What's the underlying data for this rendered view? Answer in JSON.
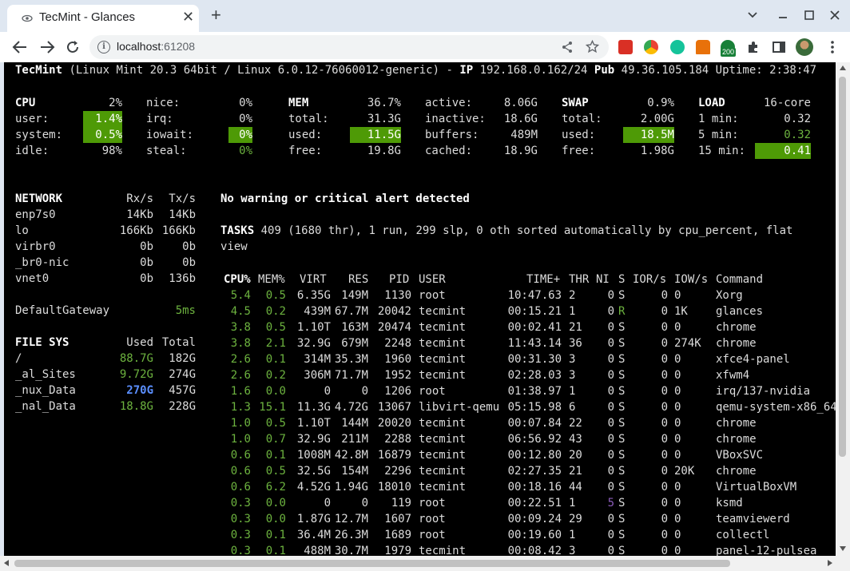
{
  "browser": {
    "tab_title": "TecMint - Glances",
    "tab_close": "✕",
    "new_tab": "+",
    "url_host": "localhost",
    "url_port": ":61208",
    "extension_badge": "200",
    "icons": [
      "back-icon",
      "forward-icon",
      "reload-icon",
      "info-icon",
      "share-icon",
      "star-icon",
      "extensions-icon",
      "side-panel-icon",
      "profile-avatar-icon",
      "menu-icon"
    ]
  },
  "header": {
    "hostname": "TecMint",
    "os": "(Linux Mint 20.3 64bit / Linux 6.0.12-76060012-generic) - ",
    "ip_label": "IP",
    "ip": "192.168.0.162/24",
    "pub_label": "Pub",
    "pub": "49.36.105.184",
    "uptime": "Uptime: 2:38:47"
  },
  "cpu": {
    "label": "CPU",
    "total": "2%",
    "user_label": "user:",
    "user": "1.4%",
    "system_label": "system:",
    "system": "0.5%",
    "idle_label": "idle:",
    "idle": "98%",
    "nice_label": "nice:",
    "nice": "0%",
    "irq_label": "irq:",
    "irq": "0%",
    "iowait_label": "iowait:",
    "iowait": "0%",
    "steal_label": "steal:",
    "steal": "0%"
  },
  "mem": {
    "label": "MEM",
    "total_pct": "36.7%",
    "total_label": "total:",
    "total": "31.3G",
    "used_label": "used:",
    "used": "11.5G",
    "free_label": "free:",
    "free": "19.8G",
    "active_label": "active:",
    "active": "8.06G",
    "inactive_label": "inactive:",
    "inactive": "18.6G",
    "buffers_label": "buffers:",
    "buffers": "489M",
    "cached_label": "cached:",
    "cached": "18.9G"
  },
  "swap": {
    "label": "SWAP",
    "pct": "0.9%",
    "total_label": "total:",
    "total": "2.00G",
    "used_label": "used:",
    "used": "18.5M",
    "free_label": "free:",
    "free": "1.98G"
  },
  "load": {
    "label": "LOAD",
    "cores": "16-core",
    "m1_label": "1 min:",
    "m1": "0.32",
    "m5_label": "5 min:",
    "m5": "0.32",
    "m15_label": "15 min:",
    "m15": "0.41"
  },
  "network": {
    "label": "NETWORK",
    "rx_label": "Rx/s",
    "tx_label": "Tx/s",
    "rows": [
      {
        "name": "enp7s0",
        "rx": "14Kb",
        "tx": "14Kb"
      },
      {
        "name": "lo",
        "rx": "166Kb",
        "tx": "166Kb"
      },
      {
        "name": "virbr0",
        "rx": "0b",
        "tx": "0b"
      },
      {
        "name": "_br0-nic",
        "rx": "0b",
        "tx": "0b"
      },
      {
        "name": "vnet0",
        "rx": "0b",
        "tx": "136b"
      }
    ],
    "gateway_label": "DefaultGateway",
    "gateway": "5ms"
  },
  "filesys": {
    "label": "FILE SYS",
    "used_label": "Used",
    "total_label": "Total",
    "rows": [
      {
        "name": "/",
        "used": "88.7G",
        "total": "182G"
      },
      {
        "name": "_al_Sites",
        "used": "9.72G",
        "total": "274G"
      },
      {
        "name": "_nux_Data",
        "used": "270G",
        "total": "457G"
      },
      {
        "name": "_nal_Data",
        "used": "18.8G",
        "total": "228G"
      }
    ]
  },
  "alert": "No warning or critical alert detected",
  "tasks": {
    "label": "TASKS",
    "line1": " 409 (1680 thr), 1 run, 299 slp, 0 oth sorted automatically by cpu_percent, flat",
    "line2": "view"
  },
  "process_header": {
    "cpu": "CPU%",
    "mem": "MEM%",
    "virt": "VIRT",
    "res": "RES",
    "pid": "PID",
    "user": "USER",
    "time": "TIME+",
    "thr": "THR",
    "ni": "NI",
    "s": "S",
    "ior": "IOR/s",
    "iow": "IOW/s",
    "cmd": "Command"
  },
  "processes": [
    {
      "cpu": "5.4",
      "mem": "0.5",
      "virt": "6.35G",
      "res": "149M",
      "pid": "1130",
      "user": "root",
      "time": "10:47.63",
      "thr": "2",
      "ni": "0",
      "s": "S",
      "ior": "0",
      "iow": "0",
      "cmd": "Xorg"
    },
    {
      "cpu": "4.5",
      "mem": "0.2",
      "virt": "439M",
      "res": "67.7M",
      "pid": "20042",
      "user": "tecmint",
      "time": "00:15.21",
      "thr": "1",
      "ni": "0",
      "s": "R",
      "ior": "0",
      "iow": "1K",
      "cmd": "glances"
    },
    {
      "cpu": "3.8",
      "mem": "0.5",
      "virt": "1.10T",
      "res": "163M",
      "pid": "20474",
      "user": "tecmint",
      "time": "00:02.41",
      "thr": "21",
      "ni": "0",
      "s": "S",
      "ior": "0",
      "iow": "0",
      "cmd": "chrome"
    },
    {
      "cpu": "3.8",
      "mem": "2.1",
      "virt": "32.9G",
      "res": "679M",
      "pid": "2248",
      "user": "tecmint",
      "time": "11:43.14",
      "thr": "36",
      "ni": "0",
      "s": "S",
      "ior": "0",
      "iow": "274K",
      "cmd": "chrome"
    },
    {
      "cpu": "2.6",
      "mem": "0.1",
      "virt": "314M",
      "res": "35.3M",
      "pid": "1960",
      "user": "tecmint",
      "time": "00:31.30",
      "thr": "3",
      "ni": "0",
      "s": "S",
      "ior": "0",
      "iow": "0",
      "cmd": "xfce4-panel"
    },
    {
      "cpu": "2.6",
      "mem": "0.2",
      "virt": "306M",
      "res": "71.7M",
      "pid": "1952",
      "user": "tecmint",
      "time": "02:28.03",
      "thr": "3",
      "ni": "0",
      "s": "S",
      "ior": "0",
      "iow": "0",
      "cmd": "xfwm4"
    },
    {
      "cpu": "1.6",
      "mem": "0.0",
      "virt": "0",
      "res": "0",
      "pid": "1206",
      "user": "root",
      "time": "01:38.97",
      "thr": "1",
      "ni": "0",
      "s": "S",
      "ior": "0",
      "iow": "0",
      "cmd": "irq/137-nvidia"
    },
    {
      "cpu": "1.3",
      "mem": "15.1",
      "virt": "11.3G",
      "res": "4.72G",
      "pid": "13067",
      "user": "libvirt-qemu",
      "time": "05:15.98",
      "thr": "6",
      "ni": "0",
      "s": "S",
      "ior": "0",
      "iow": "0",
      "cmd": "qemu-system-x86_64"
    },
    {
      "cpu": "1.0",
      "mem": "0.5",
      "virt": "1.10T",
      "res": "144M",
      "pid": "20020",
      "user": "tecmint",
      "time": "00:07.84",
      "thr": "22",
      "ni": "0",
      "s": "S",
      "ior": "0",
      "iow": "0",
      "cmd": "chrome"
    },
    {
      "cpu": "1.0",
      "mem": "0.7",
      "virt": "32.9G",
      "res": "211M",
      "pid": "2288",
      "user": "tecmint",
      "time": "06:56.92",
      "thr": "43",
      "ni": "0",
      "s": "S",
      "ior": "0",
      "iow": "0",
      "cmd": "chrome"
    },
    {
      "cpu": "0.6",
      "mem": "0.1",
      "virt": "1008M",
      "res": "42.8M",
      "pid": "16879",
      "user": "tecmint",
      "time": "00:12.80",
      "thr": "20",
      "ni": "0",
      "s": "S",
      "ior": "0",
      "iow": "0",
      "cmd": "VBoxSVC"
    },
    {
      "cpu": "0.6",
      "mem": "0.5",
      "virt": "32.5G",
      "res": "154M",
      "pid": "2296",
      "user": "tecmint",
      "time": "02:27.35",
      "thr": "21",
      "ni": "0",
      "s": "S",
      "ior": "0",
      "iow": "20K",
      "cmd": "chrome"
    },
    {
      "cpu": "0.6",
      "mem": "6.2",
      "virt": "4.52G",
      "res": "1.94G",
      "pid": "18010",
      "user": "tecmint",
      "time": "00:18.16",
      "thr": "44",
      "ni": "0",
      "s": "S",
      "ior": "0",
      "iow": "0",
      "cmd": "VirtualBoxVM"
    },
    {
      "cpu": "0.3",
      "mem": "0.0",
      "virt": "0",
      "res": "0",
      "pid": "119",
      "user": "root",
      "time": "00:22.51",
      "thr": "1",
      "ni": "5",
      "s": "S",
      "ior": "0",
      "iow": "0",
      "cmd": "ksmd"
    },
    {
      "cpu": "0.3",
      "mem": "0.0",
      "virt": "1.87G",
      "res": "12.7M",
      "pid": "1607",
      "user": "root",
      "time": "00:09.24",
      "thr": "29",
      "ni": "0",
      "s": "S",
      "ior": "0",
      "iow": "0",
      "cmd": "teamviewerd"
    },
    {
      "cpu": "0.3",
      "mem": "0.1",
      "virt": "36.4M",
      "res": "26.3M",
      "pid": "1689",
      "user": "root",
      "time": "00:19.60",
      "thr": "1",
      "ni": "0",
      "s": "S",
      "ior": "0",
      "iow": "0",
      "cmd": "collectl"
    },
    {
      "cpu": "0.3",
      "mem": "0.1",
      "virt": "488M",
      "res": "30.7M",
      "pid": "1979",
      "user": "tecmint",
      "time": "00:08.42",
      "thr": "3",
      "ni": "0",
      "s": "S",
      "ior": "0",
      "iow": "0",
      "cmd": "panel-12-pulsea"
    }
  ],
  "colors": {
    "highlight": "#4e9a06",
    "ok": "#6db33f",
    "careful": "#5b8fff",
    "nice": "#8a5cb8",
    "background": "#000000"
  }
}
